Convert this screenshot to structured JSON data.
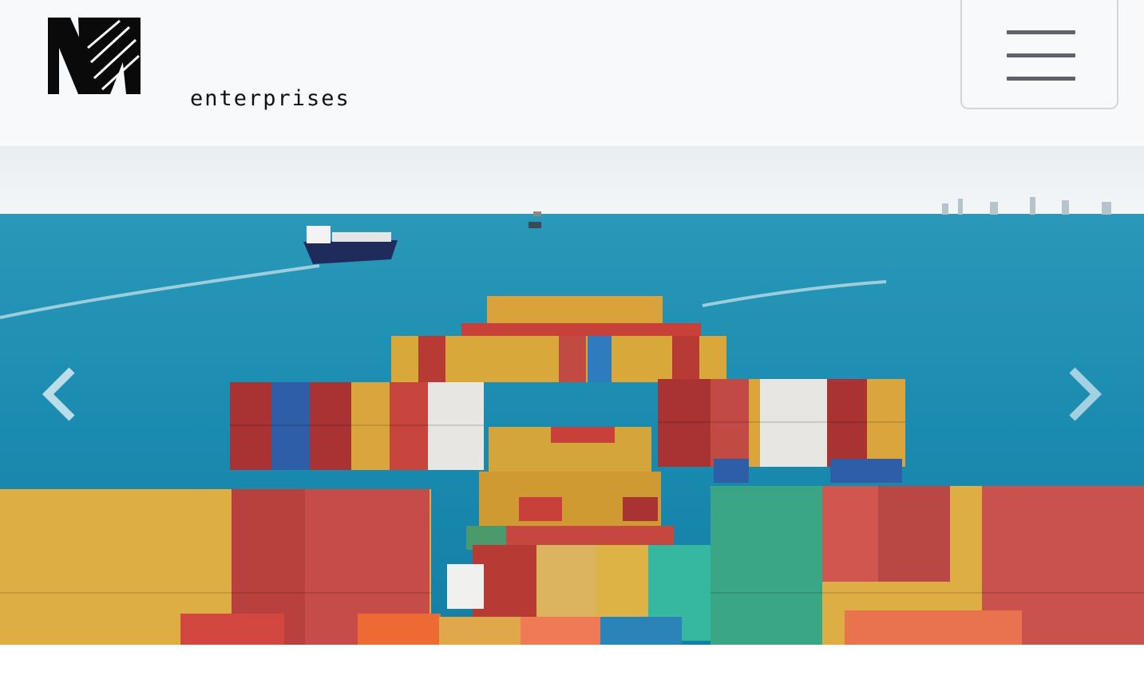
{
  "brand": {
    "logo_mark": "M",
    "logo_text": "enterprises"
  },
  "navbar": {
    "toggler_icon": "hamburger-menu-icon"
  },
  "carousel": {
    "slide_image": "cargo-ship-containers-ocean",
    "prev_icon": "chevron-left-icon",
    "next_icon": "chevron-right-icon"
  },
  "colors": {
    "navbar_bg": "#f8f9fa",
    "sea": "#1b8fb0",
    "sky": "#eef2f4"
  }
}
